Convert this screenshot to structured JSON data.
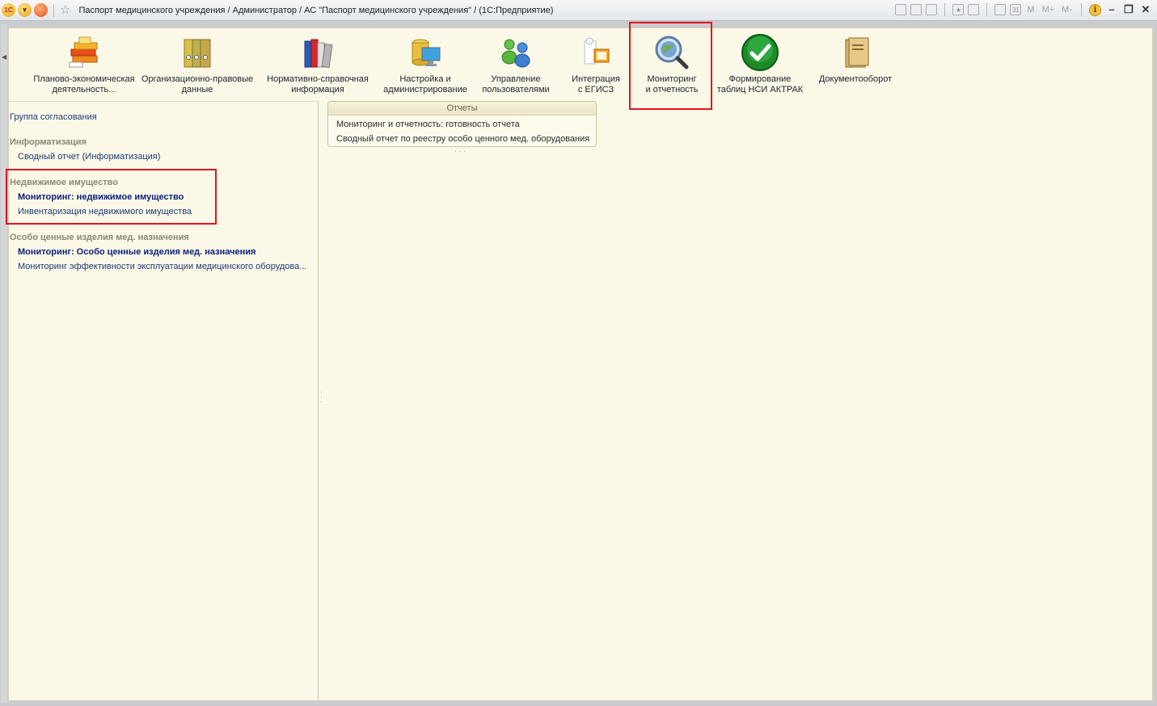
{
  "window": {
    "title": "Паспорт медицинского учреждения / Администратор / АС \"Паспорт медицинского учреждения\" /  (1С:Предприятие)",
    "toolbar_right": [
      "M",
      "M+",
      "M-"
    ]
  },
  "sections": [
    {
      "line1": "Планово-экономическая",
      "line2": "деятельность...",
      "icon": "books-stack-icon"
    },
    {
      "line1": "Организационно-правовые",
      "line2": "данные",
      "icon": "binders-icon"
    },
    {
      "line1": "Нормативно-справочная",
      "line2": "информация",
      "icon": "reference-books-icon"
    },
    {
      "line1": "Настройка и",
      "line2": "администрирование",
      "icon": "database-monitor-icon"
    },
    {
      "line1": "Управление",
      "line2": "пользователями",
      "icon": "users-icon"
    },
    {
      "line1": "Интеграция",
      "line2": "с ЕГИСЗ",
      "icon": "integration-icon"
    },
    {
      "line1": "Мониторинг",
      "line2": "и отчетность",
      "icon": "magnifier-globe-icon"
    },
    {
      "line1": "Формирование",
      "line2": "таблиц НСИ АКТРАК",
      "icon": "green-check-icon"
    },
    {
      "line1": "Документооборот",
      "line2": "",
      "icon": "document-folder-icon"
    }
  ],
  "nav": {
    "approval_group": "Группа согласования",
    "groups": [
      {
        "title": "Информатизация",
        "items": [
          "Сводный отчет (Информатизация)"
        ]
      },
      {
        "title": "Недвижимое имущество",
        "items": [
          "Мониторинг: недвижимое имущество",
          "Инвентаризация недвижимого имущества"
        ]
      },
      {
        "title": "Особо ценные изделия мед. назначения",
        "items": [
          "Мониторинг: Особо ценные изделия мед. назначения",
          "Мониторинг эффективности эксплуатации медицинского оборудова..."
        ]
      }
    ]
  },
  "reports": {
    "title": "Отчеты",
    "items": [
      "Мониторинг и отчетность: готовность отчета",
      "Сводный отчет по реестру особо ценного мед. оборудования"
    ]
  },
  "colors": {
    "accent_red": "#e3141b",
    "nav_link": "#1d3b76",
    "background": "#fbf8e8"
  }
}
